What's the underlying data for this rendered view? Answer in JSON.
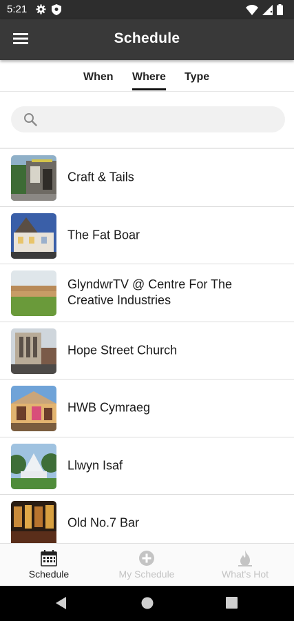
{
  "status_bar": {
    "time": "5:21",
    "left_icons": [
      "gear-icon",
      "shield-icon"
    ],
    "right_icons": [
      "wifi-icon",
      "signal-icon",
      "battery-icon"
    ]
  },
  "app_bar": {
    "title": "Schedule",
    "menu_icon": "hamburger-menu-icon"
  },
  "tabs": [
    {
      "label": "When",
      "active": false
    },
    {
      "label": "Where",
      "active": true
    },
    {
      "label": "Type",
      "active": false
    }
  ],
  "search": {
    "placeholder": "",
    "value": "",
    "icon": "search-icon"
  },
  "venues": [
    {
      "name": "Craft & Tails"
    },
    {
      "name": "The Fat Boar"
    },
    {
      "name": "GlyndwrTV @ Centre For The Creative Industries"
    },
    {
      "name": "Hope Street Church"
    },
    {
      "name": "HWB Cymraeg"
    },
    {
      "name": "Llwyn Isaf"
    },
    {
      "name": "Old No.7 Bar"
    }
  ],
  "bottom_nav": [
    {
      "label": "Schedule",
      "icon": "calendar-icon",
      "active": true
    },
    {
      "label": "My Schedule",
      "icon": "add-circle-icon",
      "active": false
    },
    {
      "label": "What's Hot",
      "icon": "flame-icon",
      "active": false
    }
  ],
  "system_nav": [
    "back-icon",
    "home-icon",
    "recents-icon"
  ],
  "colors": {
    "status_bar": "#2d2d2d",
    "app_bar": "#393939",
    "search_bg": "#f1f1f1",
    "active_text": "#222222",
    "inactive_text": "#c4c4c4"
  }
}
